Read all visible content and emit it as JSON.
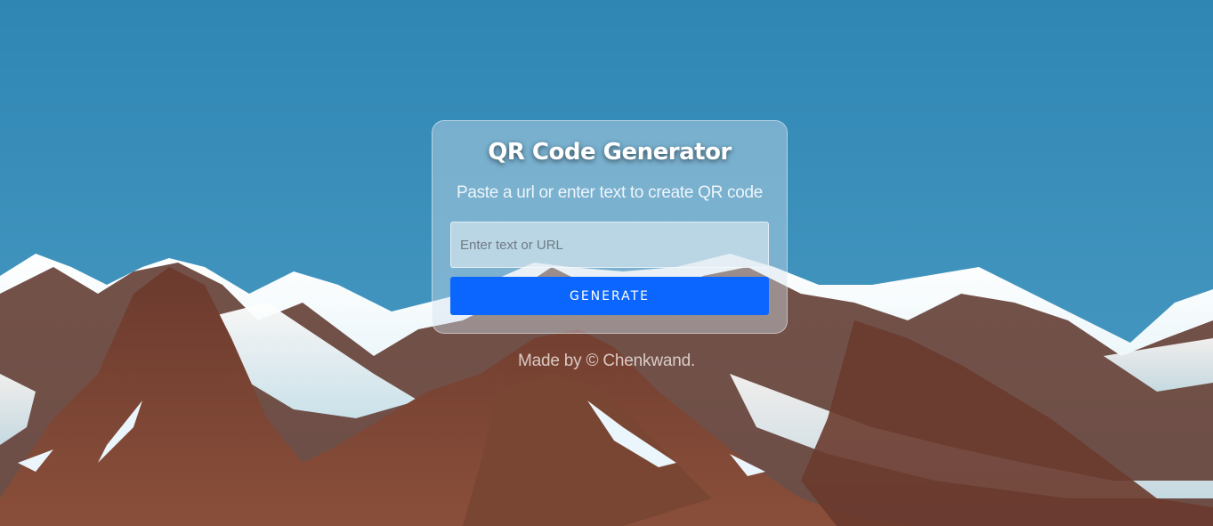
{
  "card": {
    "title": "QR Code Generator",
    "subtitle": "Paste a url or enter text to create QR code"
  },
  "input": {
    "value": "",
    "placeholder": "Enter text or URL"
  },
  "button": {
    "label": "GENERATE"
  },
  "footer": {
    "text": "Made by © Chenkwand."
  },
  "colors": {
    "sky": "#3a8fba",
    "button": "#0a66ff",
    "card": "#d2e1eb"
  }
}
